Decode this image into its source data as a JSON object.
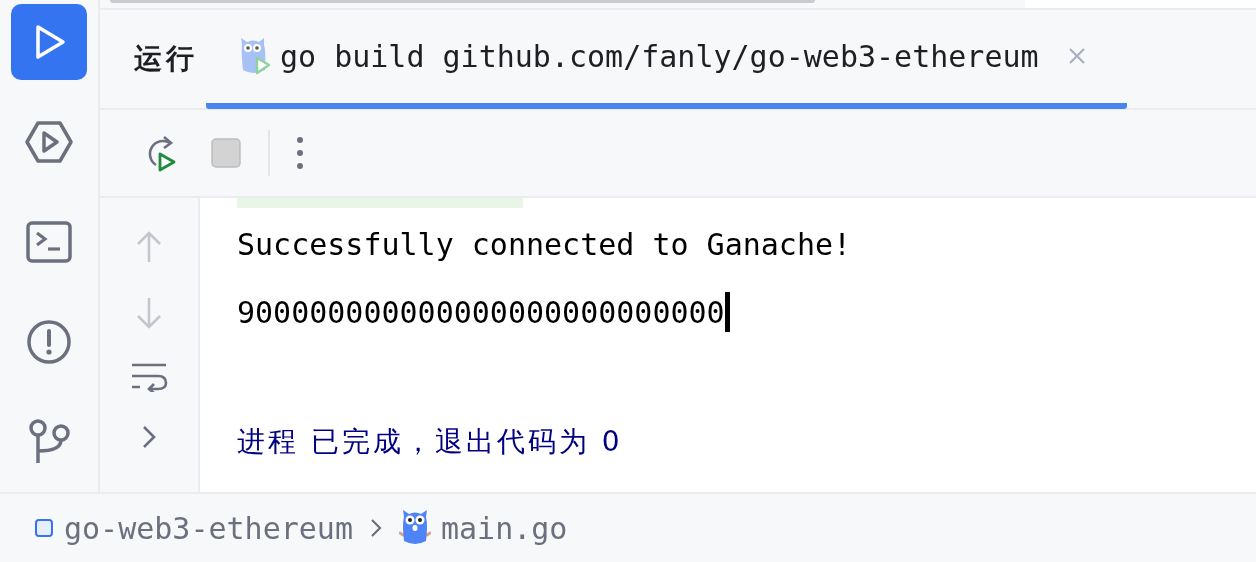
{
  "sidebar": {
    "items": [
      {
        "kind": "run",
        "selected": true
      },
      {
        "kind": "services",
        "selected": false
      },
      {
        "kind": "terminal",
        "selected": false
      },
      {
        "kind": "problems",
        "selected": false
      },
      {
        "kind": "git",
        "selected": false
      }
    ]
  },
  "run_panel": {
    "title": "运行",
    "tabs": [
      {
        "label": "go build github.com/fanly/go-web3-ethereum",
        "selected": true
      }
    ],
    "toolbar": [
      {
        "kind": "rerun"
      },
      {
        "kind": "stop",
        "disabled": true
      },
      {
        "kind": "more"
      }
    ],
    "gutter": [
      {
        "kind": "up",
        "disabled": true
      },
      {
        "kind": "down",
        "disabled": true
      },
      {
        "kind": "wrap",
        "disabled": false
      },
      {
        "kind": "expand",
        "disabled": false
      }
    ],
    "console": [
      {
        "kind": "stdout",
        "text": "Successfully connected to Ganache!",
        "cursor": false
      },
      {
        "kind": "stdout",
        "text": "900000000000000000000000000",
        "cursor": true
      },
      {
        "kind": "blank"
      },
      {
        "kind": "system",
        "text": "进程 已完成，退出代码为 0",
        "cursor": false
      }
    ]
  },
  "status_bar": {
    "breadcrumbs": [
      {
        "kind": "module",
        "label": "go-web3-ethereum"
      },
      {
        "kind": "file",
        "label": "main.go"
      }
    ]
  }
}
